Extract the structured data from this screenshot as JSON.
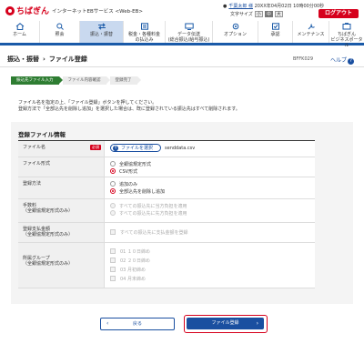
{
  "header": {
    "logo": "ちばぎん",
    "service": "インターネットEBサービス <Web-EB>",
    "user_name": "千葉太郎 様",
    "last_login": "20XX年04月02日 10時00分00秒",
    "font_size_label": "文字サイズ",
    "font_sizes": [
      "小",
      "中",
      "大"
    ],
    "logout": "ログアウト"
  },
  "nav": [
    {
      "label": "ホーム",
      "icon": "home-icon"
    },
    {
      "label": "照会",
      "icon": "search-icon"
    },
    {
      "label": "振込・振替",
      "icon": "transfer-icon",
      "active": true
    },
    {
      "label": "税金・各種料金\nの払込み",
      "icon": "tax-icon"
    },
    {
      "label": "データ伝送\n(総合振込/給与振込)",
      "icon": "data-icon"
    },
    {
      "label": "オプション",
      "icon": "option-icon"
    },
    {
      "label": "承認",
      "icon": "approve-icon"
    },
    {
      "label": "メンテナンス",
      "icon": "maintenance-icon"
    },
    {
      "label": "ちばぎん\nビジネスポータル",
      "icon": "portal-icon"
    }
  ],
  "page": {
    "title_parent": "振込・振替",
    "title": "ファイル登録",
    "code": "BFFK029",
    "help": "ヘルプ",
    "steps": [
      "振込先ファイル入力",
      "ファイル内容確認",
      "登録完了"
    ],
    "instructions": [
      "ファイル名を指定の上、「ファイル登録」ボタンを押してください。",
      "登録方法で「全部込先を削除し追加」を選択した場合は、既に登録されている振込先はすべて削除されます。"
    ]
  },
  "form": {
    "title": "登録ファイル情報",
    "file_label": "ファイル名",
    "required": "必須",
    "file_button": "ファイルを選択",
    "file_name": "senddata.csv",
    "format_label": "ファイル形式",
    "format_options": [
      "全銀協規定形式",
      "CSV形式"
    ],
    "format_selected": 1,
    "method_label": "登録方法",
    "method_options": [
      "追加のみ",
      "全部込先を削除し追加"
    ],
    "method_selected": 1,
    "fee_label": "手数料\n（全銀協規定形式のみ）",
    "fee_options": [
      "すべての振込先に当方負担を適用",
      "すべての振込先に先方負担を適用"
    ],
    "amount_label": "登録支払金額\n（全銀協規定形式のみ）",
    "amount_option": "すべての振込先に支払金額を登録",
    "group_label": "所属グループ\n（全銀協規定形式のみ）",
    "group_options": [
      "01 １０日締め",
      "02 ２０日締め",
      "03 月初締め",
      "04 月末締め"
    ]
  },
  "buttons": {
    "back": "戻る",
    "submit": "ファイル登録"
  }
}
